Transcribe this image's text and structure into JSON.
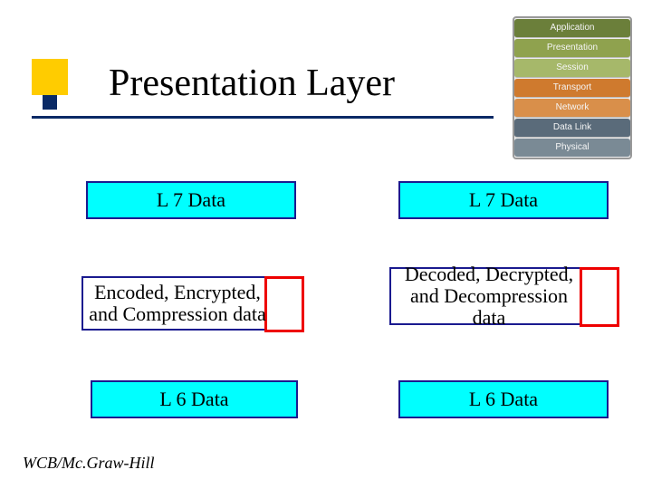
{
  "title": "Presentation Layer",
  "osi": {
    "layers": [
      "Application",
      "Presentation",
      "Session",
      "Transport",
      "Network",
      "Data Link",
      "Physical"
    ]
  },
  "boxes": {
    "l7_left": "L 7 Data",
    "l7_right": "L 7 Data",
    "enc_left": "Encoded, Encrypted, and Compression data",
    "dec_right": "Decoded, Decrypted, and Decompression data",
    "l6_left": "L 6 Data",
    "l6_right": "L 6 Data"
  },
  "footer": "WCB/Mc.Graw-Hill"
}
